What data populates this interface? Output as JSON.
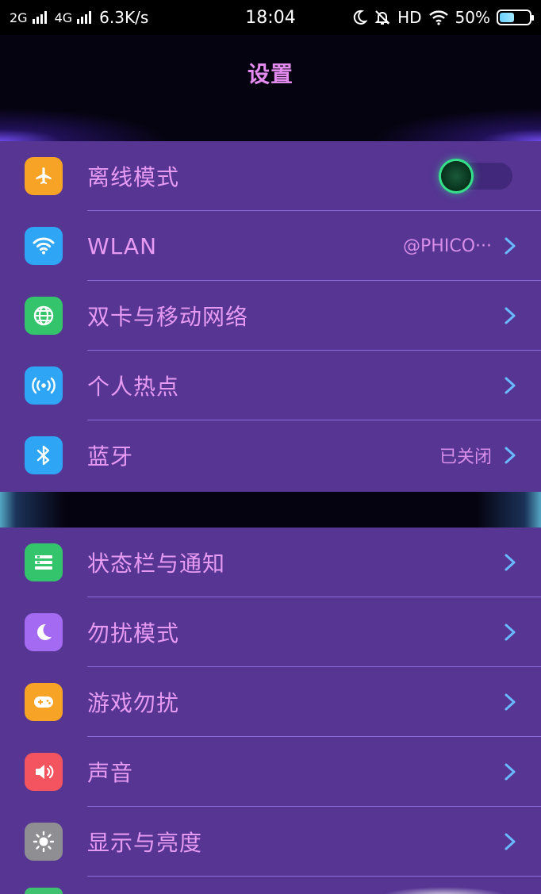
{
  "status_bar": {
    "sim1_label": "2G",
    "sim2_label": "4G",
    "speed": "6.3K/s",
    "time": "18:04",
    "hd_label": "HD",
    "battery": "50%",
    "battery_level": 0.5
  },
  "header": {
    "title": "设置"
  },
  "group1": {
    "items": [
      {
        "label": "离线模式",
        "icon": "airplane-icon",
        "icon_color": "#f7a325",
        "toggle_on": false
      },
      {
        "label": "WLAN",
        "icon": "wifi-icon",
        "icon_color": "#2ea6f5",
        "value": "@PHICO···"
      },
      {
        "label": "双卡与移动网络",
        "icon": "globe-icon",
        "icon_color": "#34c46b"
      },
      {
        "label": "个人热点",
        "icon": "hotspot-icon",
        "icon_color": "#2ea6f5"
      },
      {
        "label": "蓝牙",
        "icon": "bluetooth-icon",
        "icon_color": "#2ea6f5",
        "value": "已关闭"
      }
    ]
  },
  "group2": {
    "items": [
      {
        "label": "状态栏与通知",
        "icon": "status-bar-icon",
        "icon_color": "#34c46b"
      },
      {
        "label": "勿扰模式",
        "icon": "moon-icon",
        "icon_color": "#a46af2"
      },
      {
        "label": "游戏勿扰",
        "icon": "gamepad-icon",
        "icon_color": "#f7a325"
      },
      {
        "label": "声音",
        "icon": "speaker-icon",
        "icon_color": "#f4545f"
      },
      {
        "label": "显示与亮度",
        "icon": "brightness-icon",
        "icon_color": "#8e8e93"
      }
    ]
  },
  "colors": {
    "accent_text": "#e79af2",
    "chevron": "#6ab8ff",
    "row_bg": "#563593",
    "divider": "#8a6fd8"
  }
}
